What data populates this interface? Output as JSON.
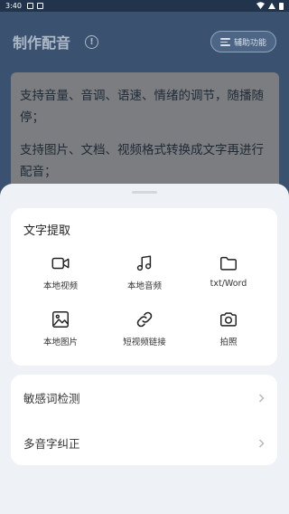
{
  "status_bar": {
    "time": "3:40"
  },
  "header": {
    "title": "制作配音",
    "assist_label": "辅助功能"
  },
  "content": {
    "paragraphs": [
      "支持音量、音调、语速、情绪的调节，随播随停；",
      "支持图片、文档、视频格式转换成文字再进行配音；"
    ]
  },
  "sheet": {
    "section_title": "文字提取",
    "items": [
      {
        "label": "本地视频",
        "icon": "video-icon"
      },
      {
        "label": "本地音频",
        "icon": "music-icon"
      },
      {
        "label": "txt/Word",
        "icon": "folder-icon"
      },
      {
        "label": "本地图片",
        "icon": "image-icon"
      },
      {
        "label": "短视频链接",
        "icon": "link-icon"
      },
      {
        "label": "拍照",
        "icon": "camera-icon"
      }
    ],
    "list": [
      {
        "label": "敏感词检测"
      },
      {
        "label": "多音字纠正"
      }
    ]
  }
}
